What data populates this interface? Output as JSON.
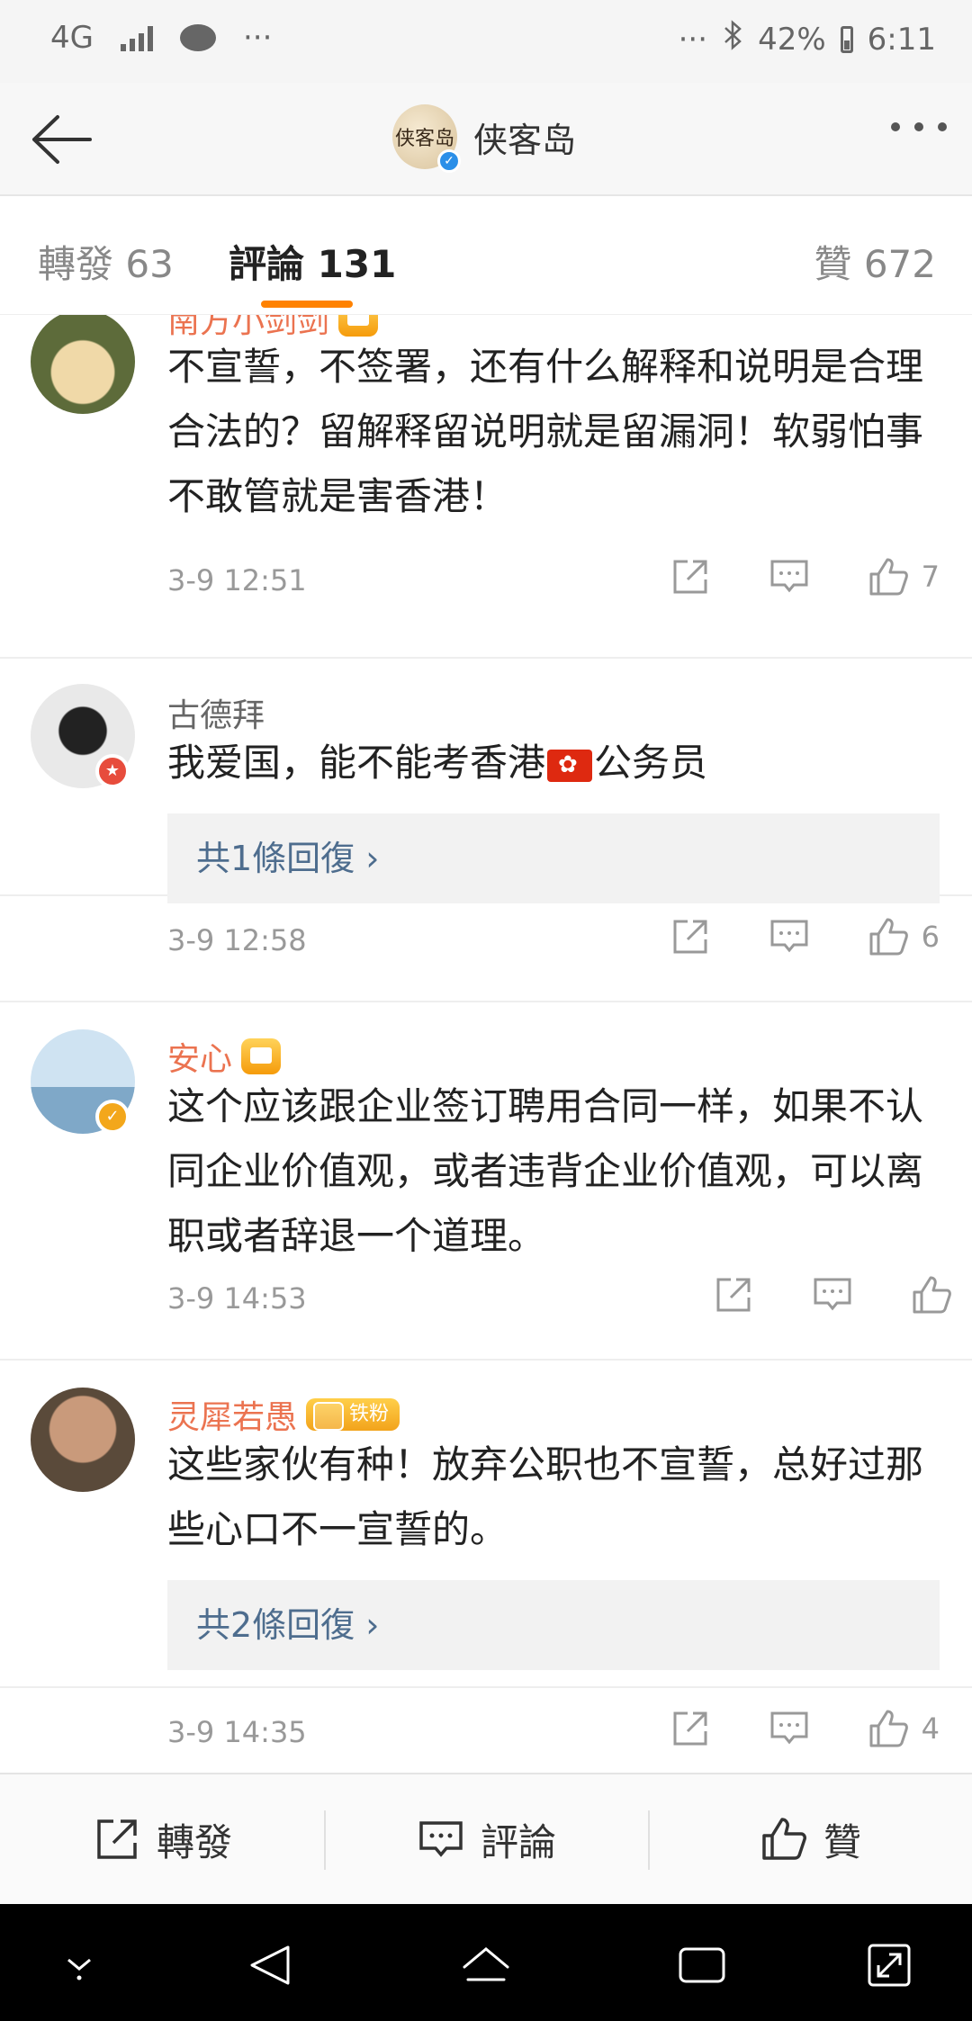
{
  "status_bar": {
    "network": "4G",
    "overflow_left": "···",
    "overflow_right": "···",
    "battery": "42%",
    "time": "6:11"
  },
  "nav": {
    "title": "侠客岛",
    "avatar_text": "侠客岛"
  },
  "tabs": [
    {
      "label": "轉發 63"
    },
    {
      "label": "評論 131"
    },
    {
      "label": "贊 672"
    }
  ],
  "comments": [
    {
      "name": "南方小剑剑",
      "text": "不宣誓，不签署，还有什么解释和说明是合理合法的？留解释留说明就是留漏洞！软弱怕事不敢管就是害香港！",
      "time": "3-9 12:51",
      "likes": "7"
    },
    {
      "name": "古德拜",
      "text_before_flag": "我爱国，能不能考香港",
      "text_after_flag": "公务员",
      "reply_label": "共1條回復 ›",
      "time": "3-9 12:58",
      "likes": "6"
    },
    {
      "name": "安心",
      "text": "这个应该跟企业签订聘用合同一样，如果不认同企业价值观，或者违背企业价值观，可以离职或者辞退一个道理。",
      "time": "3-9 14:53",
      "likes": ""
    },
    {
      "name": "灵犀若愚",
      "fan_badge": "铁粉",
      "text": "这些家伙有种！放弃公职也不宣誓，总好过那些心口不一宣誓的。",
      "reply_label": "共2條回復 ›",
      "time": "3-9 14:35",
      "likes": "4"
    }
  ],
  "toolbar": {
    "repost": "轉發",
    "comment": "評論",
    "like": "贊"
  },
  "icons": {
    "back": "back-arrow-icon",
    "more": "more-dots-icon",
    "share": "share-icon",
    "reply": "comment-icon",
    "like": "thumbs-up-icon"
  },
  "colors": {
    "accent": "#ff8200",
    "vip_name": "#eb7350",
    "link": "#4e6d8e"
  }
}
